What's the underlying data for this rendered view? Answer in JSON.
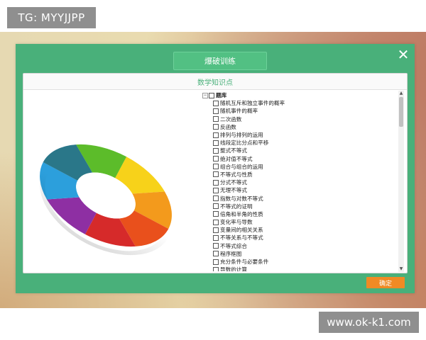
{
  "watermarks": {
    "top_left": "TG: MYYJJPP",
    "bottom_right": "www.ok-k1.com"
  },
  "dialog": {
    "title": "爆破训练",
    "close_glyph": "✕",
    "panel_title": "数学知识点",
    "confirm_label": "确定"
  },
  "tree": {
    "root_label": "题库",
    "items": [
      "随机互斥和独立事件的概率",
      "随机事件的概率",
      "二次函数",
      "反函数",
      "排列与排列的运用",
      "线段定比分点和平移",
      "整式不等式",
      "绝对值不等式",
      "组合与组合的运用",
      "不等式与性质",
      "分式不等式",
      "无理不等式",
      "指数与对数不等式",
      "不等式的证明",
      "倍角和半角的性质",
      "变化率与导数",
      "变量间的相关关系",
      "不等关系与不等式",
      "不等式综合",
      "程序框图",
      "充分条件与必要条件",
      "导数的计算"
    ]
  },
  "colors": {
    "dialog_green": "#49b07a",
    "confirm_orange": "#f08a24",
    "panel_title_green": "#49b07a"
  },
  "icons": {
    "close": "close-icon",
    "collapse": "tree-collapse-icon",
    "checkbox": "checkbox-icon"
  }
}
